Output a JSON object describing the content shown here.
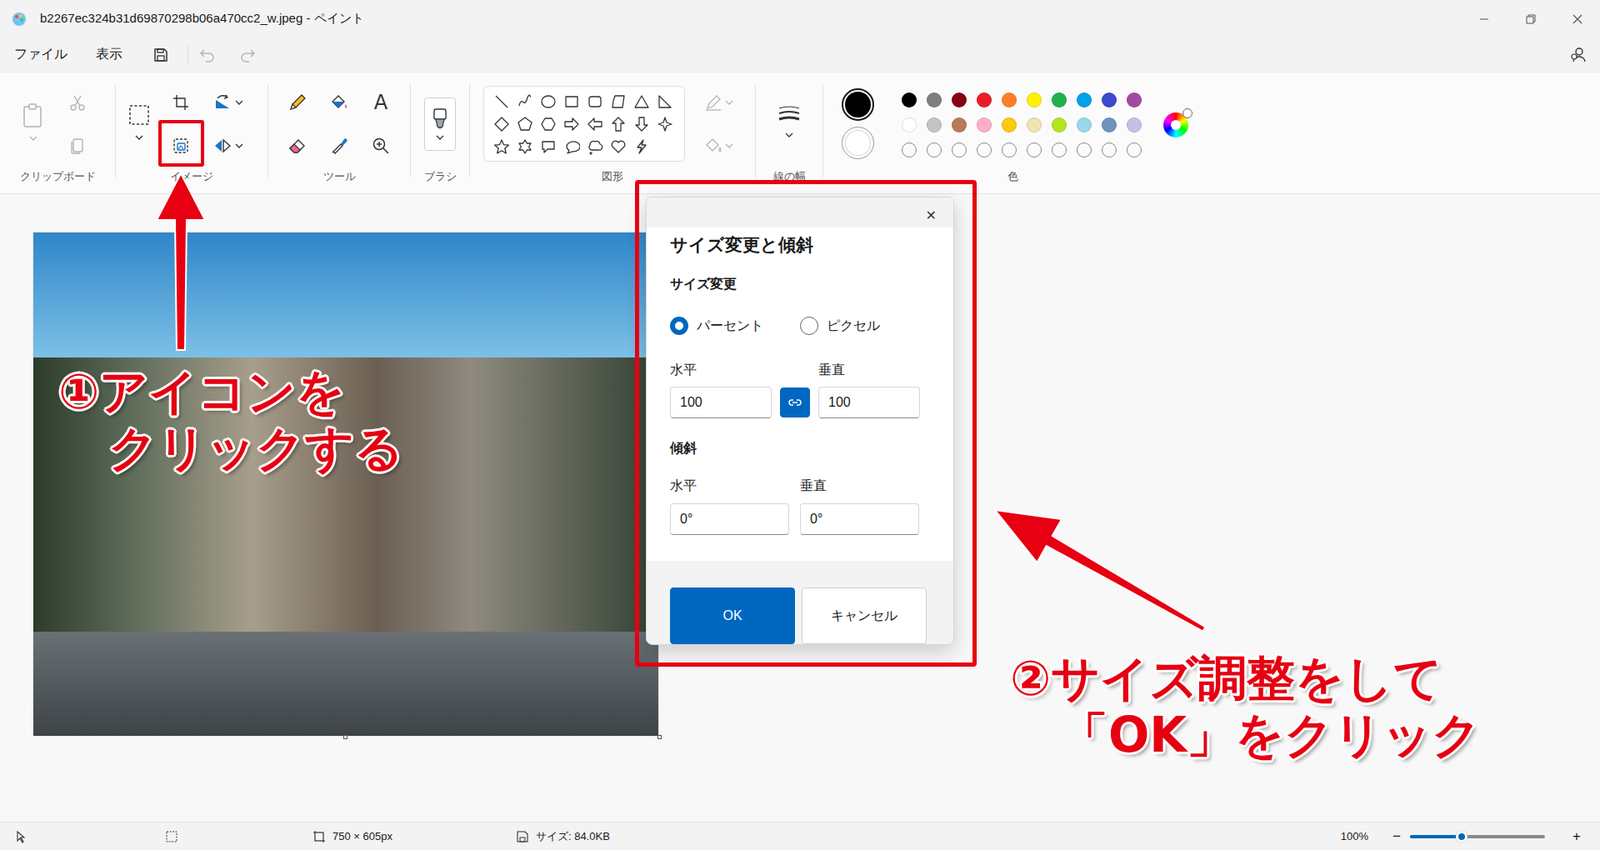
{
  "window": {
    "title": "b2267ec324b31d69870298b06a470cc2_w.jpeg - ペイント"
  },
  "menu": [
    "ファイル",
    "表示"
  ],
  "quick_access": [
    {
      "kind": "save",
      "disabled": false
    },
    {
      "kind": "undo",
      "disabled": true
    },
    {
      "kind": "redo",
      "disabled": true
    }
  ],
  "ribbon": {
    "groups": [
      {
        "label": "クリップボード"
      },
      {
        "label": "イメージ"
      },
      {
        "label": "ツール"
      },
      {
        "label": "ブラシ"
      },
      {
        "label": "図形"
      },
      {
        "label": "線の幅"
      },
      {
        "label": "色"
      }
    ],
    "clipboard": [
      {
        "kind": "paste",
        "disabled": true
      },
      {
        "kind": "cut",
        "disabled": true
      },
      {
        "kind": "copy",
        "disabled": true
      }
    ],
    "text_tool": "A",
    "shape_style": [
      {
        "kind": "outline",
        "disabled": true
      },
      {
        "kind": "fill",
        "disabled": true
      }
    ],
    "current_colors": [
      {
        "color": "#000000",
        "selected": true
      },
      {
        "color": "#ffffff",
        "selected": false
      }
    ],
    "palette": [
      {
        "kind": "swatch",
        "color": "#000000"
      },
      {
        "kind": "swatch",
        "color": "#7f7f7f"
      },
      {
        "kind": "swatch",
        "color": "#880015"
      },
      {
        "kind": "swatch",
        "color": "#ed1c24"
      },
      {
        "kind": "swatch",
        "color": "#ff7f27"
      },
      {
        "kind": "swatch",
        "color": "#fff200"
      },
      {
        "kind": "swatch",
        "color": "#22b14c"
      },
      {
        "kind": "swatch",
        "color": "#00a2e8"
      },
      {
        "kind": "swatch",
        "color": "#3f48cc"
      },
      {
        "kind": "swatch",
        "color": "#a349a4"
      },
      {
        "kind": "swatch",
        "color": "#ffffff"
      },
      {
        "kind": "swatch",
        "color": "#c3c3c3"
      },
      {
        "kind": "swatch",
        "color": "#b97a57"
      },
      {
        "kind": "swatch",
        "color": "#ffaec9"
      },
      {
        "kind": "swatch",
        "color": "#ffc90e"
      },
      {
        "kind": "swatch",
        "color": "#efe4b0"
      },
      {
        "kind": "swatch",
        "color": "#b5e61d"
      },
      {
        "kind": "swatch",
        "color": "#99d9ea"
      },
      {
        "kind": "swatch",
        "color": "#7092be"
      },
      {
        "kind": "swatch",
        "color": "#c8bfe7"
      },
      {
        "kind": "empty"
      },
      {
        "kind": "empty"
      },
      {
        "kind": "empty"
      },
      {
        "kind": "empty"
      },
      {
        "kind": "empty"
      },
      {
        "kind": "empty"
      },
      {
        "kind": "empty"
      },
      {
        "kind": "empty"
      },
      {
        "kind": "empty"
      },
      {
        "kind": "empty"
      }
    ]
  },
  "dialog": {
    "title": "サイズ変更と傾斜",
    "close": "✕",
    "resize": {
      "label": "サイズ変更",
      "units": [
        {
          "label": "パーセント",
          "selected": true
        },
        {
          "label": "ピクセル",
          "selected": false
        }
      ],
      "horizontal": {
        "label": "水平",
        "value": "100"
      },
      "vertical": {
        "label": "垂直",
        "value": "100"
      },
      "aspect_locked": true
    },
    "skew": {
      "label": "傾斜",
      "horizontal": {
        "label": "水平",
        "value": "0°"
      },
      "vertical": {
        "label": "垂直",
        "value": "0°"
      }
    },
    "buttons": [
      {
        "label": "OK",
        "primary": true
      },
      {
        "label": "キャンセル",
        "primary": false
      }
    ]
  },
  "status_bar": {
    "dimensions": "750 × 605px",
    "size": "サイズ: 84.0KB",
    "zoom": "100%",
    "zoom_out": "−",
    "zoom_in": "+",
    "zoom_level": 0.38
  },
  "annotations": [
    {
      "lines": [
        "①アイコンを",
        "クリックする"
      ],
      "boxed_icon": true
    },
    {
      "lines": [
        "②サイズ調整をして",
        "「OK」をクリック"
      ],
      "boxed_icon": false
    }
  ]
}
